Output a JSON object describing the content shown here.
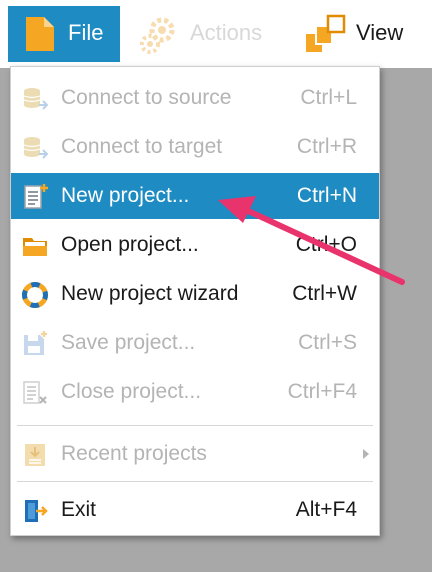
{
  "ribbon": {
    "file_tab": {
      "label": "File",
      "icon": "file-icon"
    },
    "actions_button": {
      "label": "Actions",
      "icon": "gears-icon",
      "enabled": false
    },
    "view_button": {
      "label": "View",
      "icon": "view-icon"
    }
  },
  "menu": {
    "items": [
      {
        "label": "Connect to source",
        "shortcut": "Ctrl+L",
        "icon": "database-connect-icon",
        "enabled": false
      },
      {
        "label": "Connect to target",
        "shortcut": "Ctrl+R",
        "icon": "database-connect-icon",
        "enabled": false
      },
      {
        "label": "New project...",
        "shortcut": "Ctrl+N",
        "icon": "new-document-icon",
        "enabled": true,
        "selected": true
      },
      {
        "label": "Open project...",
        "shortcut": "Ctrl+O",
        "icon": "folder-icon",
        "enabled": true
      },
      {
        "label": "New project wizard",
        "shortcut": "Ctrl+W",
        "icon": "lifebuoy-icon",
        "enabled": true
      },
      {
        "label": "Save project...",
        "shortcut": "Ctrl+S",
        "icon": "save-icon",
        "enabled": false
      },
      {
        "label": "Close project...",
        "shortcut": "Ctrl+F4",
        "icon": "close-document-icon",
        "enabled": false
      }
    ],
    "recent": {
      "label": "Recent projects",
      "icon": "recent-icon",
      "enabled": false
    },
    "exit": {
      "label": "Exit",
      "shortcut": "Alt+F4",
      "icon": "exit-door-icon",
      "enabled": true
    }
  },
  "colors": {
    "accent": "#1e8bc3",
    "pointer": "#e8336d",
    "disabled_text": "#b4b4b4",
    "workspace": "#a8a8a8"
  }
}
